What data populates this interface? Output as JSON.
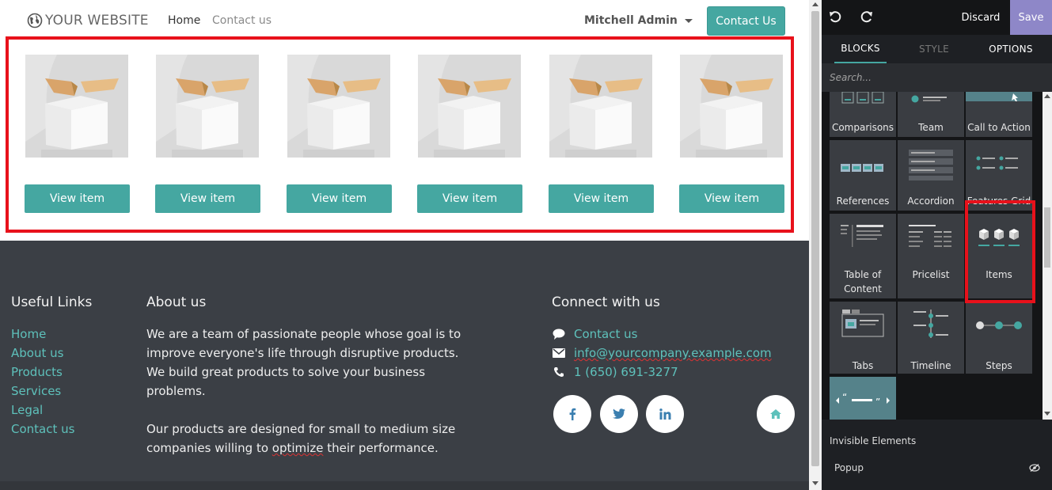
{
  "site": {
    "logo_text": "YOUR WEBSITE",
    "nav": {
      "home": "Home",
      "contact": "Contact us"
    },
    "user": "Mitchell Admin",
    "contact_button": "Contact Us",
    "items": [
      {
        "button": "View item"
      },
      {
        "button": "View item"
      },
      {
        "button": "View item"
      },
      {
        "button": "View item"
      },
      {
        "button": "View item"
      },
      {
        "button": "View item"
      }
    ],
    "footer": {
      "useful_links_title": "Useful Links",
      "links": [
        "Home",
        "About us",
        "Products",
        "Services",
        "Legal",
        "Contact us"
      ],
      "about_title": "About us",
      "about_p1": "We are a team of passionate people whose goal is to improve everyone's life through disruptive products. We build great products to solve your business problems.",
      "about_p2_before": "Our products are designed for small to medium size companies willing to ",
      "about_p2_word": "optimize",
      "about_p2_after": " their performance.",
      "connect_title": "Connect with us",
      "contact_link": "Contact us",
      "email": "info@yourcompany.example.com",
      "phone": "1 (650) 691-3277",
      "social": [
        "facebook-icon",
        "twitter-icon",
        "linkedin-icon",
        "home-icon"
      ]
    }
  },
  "editor": {
    "discard": "Discard",
    "save": "Save",
    "tabs": {
      "blocks": "BLOCKS",
      "style": "STYLE",
      "options": "OPTIONS"
    },
    "search_placeholder": "Search...",
    "blocks": {
      "comparisons": "Comparisons",
      "team": "Team",
      "cta": "Call to Action",
      "references": "References",
      "accordion": "Accordion",
      "features_grid": "Features Grid",
      "toc_line1": "Table of",
      "toc_line2": "Content",
      "pricelist": "Pricelist",
      "items": "Items",
      "tabs": "Tabs",
      "timeline": "Timeline",
      "steps": "Steps"
    },
    "invisible_title": "Invisible Elements",
    "popup": "Popup"
  },
  "colors": {
    "accent": "#45a7a1",
    "link": "#5ec1bb",
    "footer_bg": "#3b3f45",
    "save_bg": "#8e87c8",
    "highlight": "#e8111b"
  }
}
